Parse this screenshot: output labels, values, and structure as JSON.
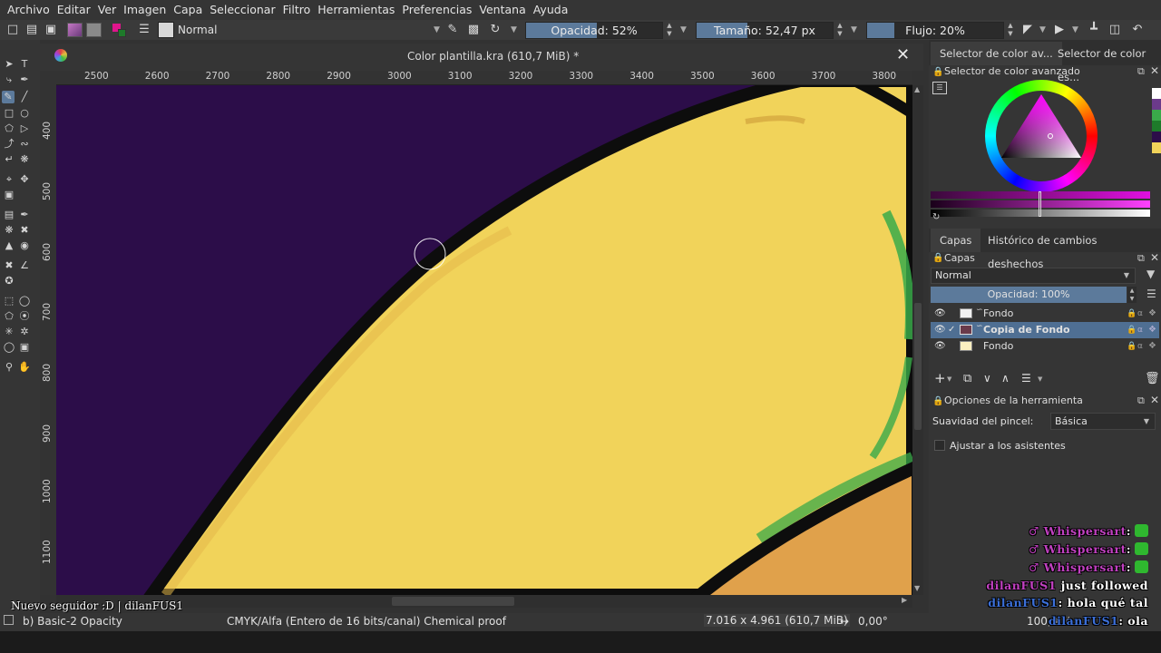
{
  "menu": [
    "Archivo",
    "Editar",
    "Ver",
    "Imagen",
    "Capa",
    "Seleccionar",
    "Filtro",
    "Herramientas",
    "Preferencias",
    "Ventana",
    "Ayuda"
  ],
  "toolbar": {
    "blend_mode": "Normal",
    "opacity_label": "Opacidad: 52%",
    "opacity_value": 0.52,
    "size_label": "Tamaño: 52,47 px",
    "flow_label": "Flujo: 20%",
    "flow_value": 0.2
  },
  "document": {
    "title": "Color plantilla.kra (610,7 MiB) *",
    "ruler_x": [
      "2500",
      "2600",
      "2700",
      "2800",
      "2900",
      "3000",
      "3100",
      "3200",
      "3300",
      "3400",
      "3500",
      "3600",
      "3700",
      "3800"
    ],
    "ruler_y": [
      "400",
      "500",
      "600",
      "700",
      "800",
      "900",
      "1000",
      "1100"
    ]
  },
  "dock": {
    "tab_advanced_selector": "Selector de color av...",
    "tab_other_selector": "Selector de color es...",
    "advanced_selector_title": "Selector de color avanzado",
    "layers_tab": "Capas",
    "history_tab": "Histórico de cambios deshechos",
    "layers_title": "Capas",
    "layer_blend_mode": "Normal",
    "layer_opacity_label": "Opacidad:  100%",
    "layers": [
      {
        "name": "Fondo",
        "selected": false
      },
      {
        "name": "Copia de Fondo",
        "selected": true
      },
      {
        "name": "Fondo",
        "selected": false
      }
    ],
    "tool_options_title": "Opciones de la herramienta",
    "brush_smoothing_label": "Suavidad del pincel:",
    "brush_smoothing_value": "Básica",
    "snap_assistants_label": "Ajustar a los asistentes"
  },
  "status": {
    "brush_preset": "b) Basic-2 Opacity",
    "color_space": "CMYK/Alfa (Entero de 16 bits/canal)  Chemical proof",
    "dimensions": "7.016 x 4.961 (610,7 MiB)",
    "rotation": "0,00°",
    "zoom": "100,0 %"
  },
  "overlay": {
    "new_follower": "Nuevo seguidor :D | dilanFUS1",
    "chat": [
      {
        "user": "Whispersart",
        "text": ":"
      },
      {
        "user": "Whispersart",
        "text": ":"
      },
      {
        "user": "Whispersart",
        "text": ":"
      },
      {
        "user": "dilanFUS1",
        "text": " just followed"
      },
      {
        "user": "dilanFUS1",
        "text": ": hola qué tal"
      },
      {
        "user": "dilanFUS1",
        "text": ": ola"
      }
    ]
  },
  "colors": {
    "canvas_bg": "#2c0d49",
    "fill_yellow": "#f1d35a",
    "fill_orange": "#e0a14b",
    "accent_green": "#3aaa4a",
    "selection_blue": "#5c7a9b",
    "chat_purple": "#c040c0",
    "chat_blue": "#3b6fd8"
  }
}
